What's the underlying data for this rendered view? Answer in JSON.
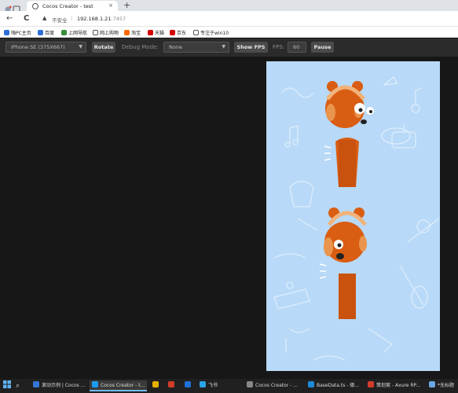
{
  "browser": {
    "tab_title": "Cocos Creator - test",
    "new_tab": "+",
    "back": "←",
    "reload": "C",
    "security_warning": "不安全",
    "url_host": "192.168.1.21",
    "url_port": ":7457"
  },
  "bookmarks": [
    {
      "label": "嗨PC主页",
      "color": "#2f6fd6"
    },
    {
      "label": "百度",
      "color": "#2f6fd6"
    },
    {
      "label": "上网导航",
      "color": "#3a8d3a"
    },
    {
      "label": "网上购物",
      "color": "#555555"
    },
    {
      "label": "淘宝",
      "color": "#ff6a00"
    },
    {
      "label": "天猫",
      "color": "#d40000"
    },
    {
      "label": "京东",
      "color": "#d40000"
    },
    {
      "label": "专注于win10",
      "color": "#555555"
    }
  ],
  "toolbar": {
    "device": "iPhone SE (375X667)",
    "rotate": "Rotate",
    "debug_label": "Debug Mode:",
    "debug_value": "None",
    "show_fps": "Show FPS",
    "fps_label": "FPS:",
    "fps_value": "60",
    "pause": "Pause"
  },
  "taskbar": [
    {
      "label": "滚动示例 | Cocos ...",
      "color": "#3277d6"
    },
    {
      "label": "Cocos Creator - t...",
      "color": "#1b9cf2",
      "active": true
    },
    {
      "label": "",
      "color": "#e6b000"
    },
    {
      "label": "",
      "color": "#d23c2a"
    },
    {
      "label": "",
      "color": "#1d70d6"
    },
    {
      "label": "飞书",
      "color": "#2aa4e8"
    },
    {
      "label": "Cocos Creator - ...",
      "color": "#888888"
    },
    {
      "label": "BaseData.ts - 德...",
      "color": "#1e8ad8"
    },
    {
      "label": "策划案 - Axure RP...",
      "color": "#d23c2a"
    },
    {
      "label": "*无标题",
      "color": "#6aa7e0"
    }
  ],
  "colors": {
    "canvas_bg": "#b8d9f7",
    "body_orange": "#d95d12",
    "toolbar_bg": "#2b2b2b"
  }
}
